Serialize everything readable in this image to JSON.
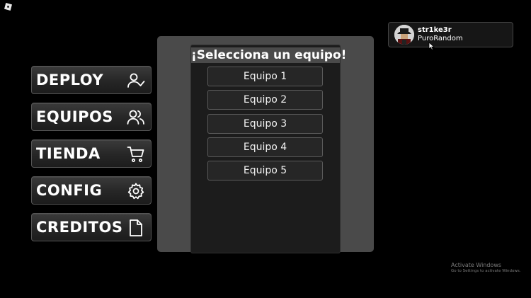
{
  "menu": {
    "items": [
      {
        "label": "DEPLOY",
        "icon": "user-check-icon"
      },
      {
        "label": "EQUIPOS",
        "icon": "users-icon"
      },
      {
        "label": "TIENDA",
        "icon": "cart-icon"
      },
      {
        "label": "CONFIG",
        "icon": "gear-icon"
      },
      {
        "label": "CREDITOS",
        "icon": "file-icon"
      }
    ]
  },
  "team_select": {
    "title": "¡Selecciona un equipo!",
    "teams": [
      "Equipo 1",
      "Equipo 2",
      "Equipo 3",
      "Equipo 4",
      "Equipo 5"
    ]
  },
  "user": {
    "username": "str1ke3r",
    "display_name": "PuroRandom"
  },
  "watermark": {
    "title": "Activate Windows",
    "subtitle": "Go to Settings to activate Windows."
  }
}
